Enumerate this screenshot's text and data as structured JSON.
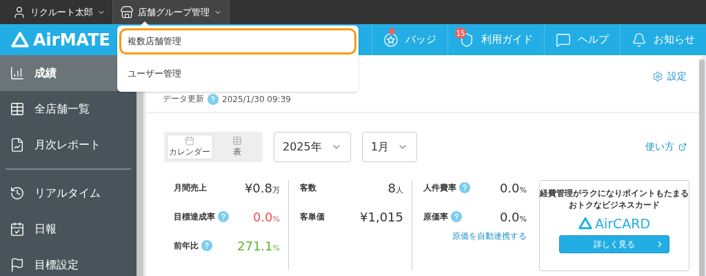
{
  "top_bar": {
    "items": [
      {
        "label": "リクルート太郎",
        "selected": false
      },
      {
        "label": "店舗グループ管理",
        "selected": true
      }
    ]
  },
  "dropdown": {
    "items": [
      {
        "label": "複数店舗管理",
        "selected": true
      },
      {
        "label": "ユーザー管理",
        "selected": false
      }
    ]
  },
  "logo": {
    "text": "AirMATE"
  },
  "header_nav": [
    {
      "label": "バッジ",
      "dot": true
    },
    {
      "label": "利用ガイド",
      "dot": false,
      "badge": "15"
    },
    {
      "label": "ヘルプ",
      "dot": false
    },
    {
      "label": "お知らせ",
      "dot": false
    }
  ],
  "sidebar": {
    "groups": [
      [
        {
          "label": "成績",
          "selected": true
        },
        {
          "label": "全店舗一覧",
          "selected": false
        },
        {
          "label": "月次レポート",
          "selected": false
        }
      ],
      [
        {
          "label": "リアルタイム",
          "selected": false
        },
        {
          "label": "日報",
          "selected": false
        },
        {
          "label": "目標設定",
          "selected": false
        }
      ]
    ]
  },
  "page_header": {
    "update_label": "データ更新",
    "update_time": "2025/1/30 09:39",
    "settings": "設定"
  },
  "view_toggle": [
    {
      "label": "カレンダー",
      "selected": true
    },
    {
      "label": "表",
      "selected": false
    }
  ],
  "selects": [
    {
      "value": "2025年"
    },
    {
      "value": "1月"
    }
  ],
  "howto_link": "使い方",
  "metric_columns": [
    [
      {
        "label": "月間売上",
        "help": false,
        "value": "¥0.8",
        "unit": "万"
      },
      {
        "label": "目標達成率",
        "help": true,
        "value": "0.0",
        "unit": "%",
        "color": "#f0504a"
      },
      {
        "label": "前年比",
        "help": true,
        "value": "271.1",
        "unit": "%",
        "color": "#5cb82e"
      }
    ],
    [
      {
        "label": "客数",
        "help": false,
        "value": "8",
        "unit": "人"
      },
      {
        "label": "客単価",
        "help": false,
        "value": "¥1,015"
      }
    ],
    [
      {
        "label": "人件費率",
        "help": true,
        "value": "0.0",
        "unit": "%"
      },
      {
        "label": "原価率",
        "help": true,
        "value": "0.0",
        "unit": "%"
      }
    ]
  ],
  "cost_link": "原価を自動連携する",
  "ad_card": {
    "text_lines": [
      "経費管理がラクになりポイントもたまる",
      "おトクなビジネスカード"
    ],
    "logo": "AirCARD",
    "button": "詳しく見る"
  }
}
